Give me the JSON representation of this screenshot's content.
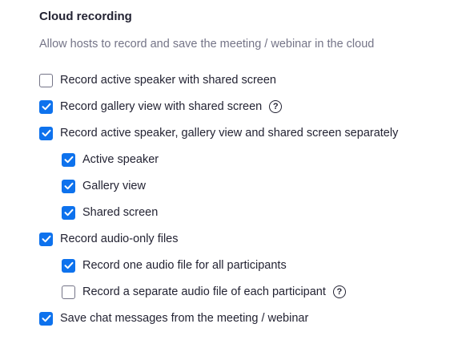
{
  "section": {
    "title": "Cloud recording",
    "description": "Allow hosts to record and save the meeting / webinar in the cloud"
  },
  "colors": {
    "checked": "#0e72ed",
    "unchecked_border": "#747487",
    "text": "#232333",
    "muted_text": "#747487"
  },
  "options": [
    {
      "id": "active-speaker-shared-screen",
      "label": "Record active speaker with shared screen",
      "checked": false,
      "level": 1,
      "help_icon": false
    },
    {
      "id": "gallery-view-shared-screen",
      "label": "Record gallery view with shared screen",
      "checked": true,
      "level": 1,
      "help_icon": true,
      "help_glyph": "?"
    },
    {
      "id": "separately",
      "label": "Record active speaker, gallery view and shared screen separately",
      "checked": true,
      "level": 1,
      "help_icon": false
    },
    {
      "id": "active-speaker",
      "label": "Active speaker",
      "checked": true,
      "level": 2,
      "help_icon": false
    },
    {
      "id": "gallery-view",
      "label": "Gallery view",
      "checked": true,
      "level": 2,
      "help_icon": false
    },
    {
      "id": "shared-screen",
      "label": "Shared screen",
      "checked": true,
      "level": 2,
      "help_icon": false
    },
    {
      "id": "audio-only",
      "label": "Record audio-only files",
      "checked": true,
      "level": 1,
      "help_icon": false
    },
    {
      "id": "one-audio-file",
      "label": "Record one audio file for all participants",
      "checked": true,
      "level": 2,
      "help_icon": false
    },
    {
      "id": "separate-audio-file",
      "label": "Record a separate audio file of each participant",
      "checked": false,
      "level": 2,
      "help_icon": true,
      "help_glyph": "?"
    },
    {
      "id": "chat-messages",
      "label": "Save chat messages from the meeting / webinar",
      "checked": true,
      "level": 1,
      "help_icon": false
    }
  ]
}
